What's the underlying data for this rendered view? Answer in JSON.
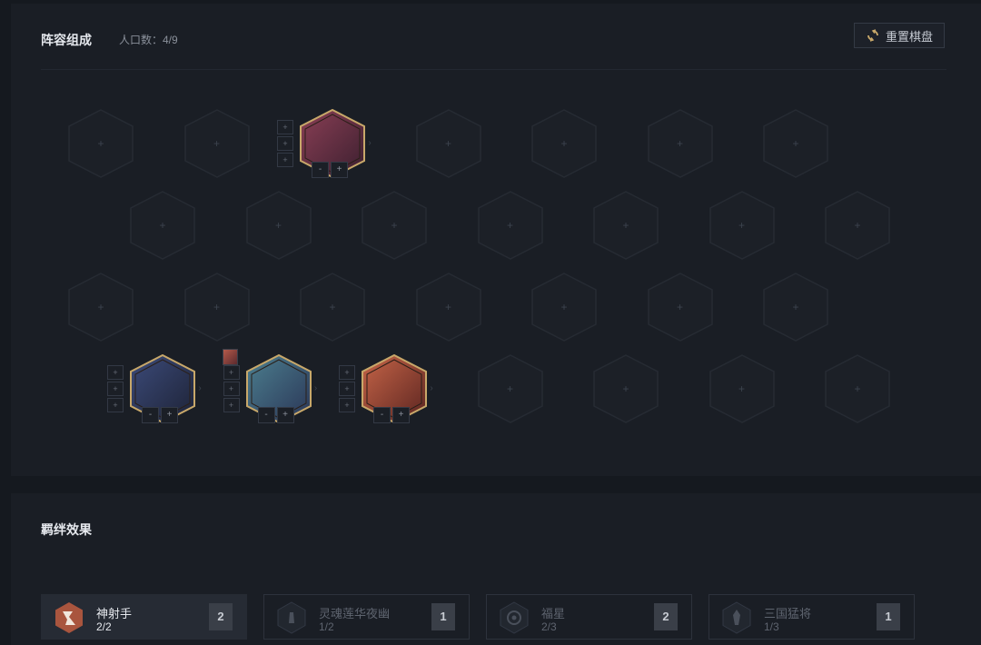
{
  "board": {
    "title": "阵容组成",
    "population_label": "人口数：4/9",
    "reset_button": "重置棋盘",
    "empty_slot_symbol": "+",
    "item_slot_symbol": "+",
    "star_down": "-",
    "star_up": "+",
    "champions": [
      {
        "name": "tahm-kench-portrait",
        "row": 0,
        "col": 2
      },
      {
        "name": "champion-portrait-1",
        "row": 3,
        "col": 0
      },
      {
        "name": "champion-portrait-2",
        "row": 3,
        "col": 1
      },
      {
        "name": "champion-portrait-3",
        "row": 3,
        "col": 2
      }
    ]
  },
  "traits": {
    "title": "羁绊效果",
    "items": [
      {
        "name": "神射手",
        "count": "2/2",
        "badge": "2",
        "active": true,
        "icon": "marksman-icon",
        "color": "#a9553e"
      },
      {
        "name": "灵魂莲华夜幽",
        "count": "1/2",
        "badge": "1",
        "active": false,
        "icon": "spirit-blossom-icon",
        "color": "#3a3f48"
      },
      {
        "name": "福星",
        "count": "2/3",
        "badge": "2",
        "active": false,
        "icon": "fortune-icon",
        "color": "#3a3f48"
      },
      {
        "name": "三国猛将",
        "count": "1/3",
        "badge": "1",
        "active": false,
        "icon": "warlord-icon",
        "color": "#3a3f48"
      }
    ]
  },
  "colors": {
    "gold_frame": "#c8a86a",
    "active_trait": "#a9553e"
  }
}
